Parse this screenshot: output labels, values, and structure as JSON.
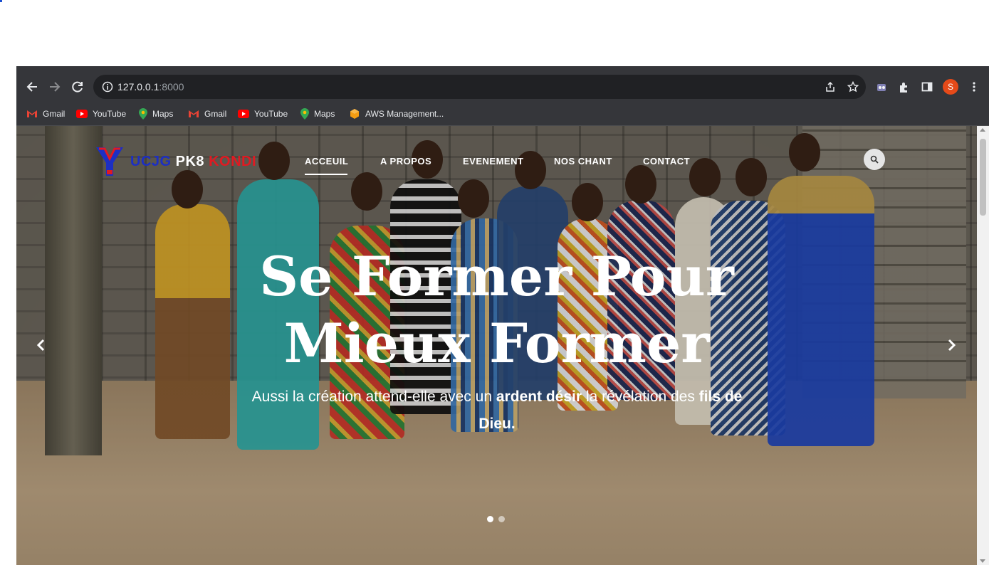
{
  "browser": {
    "url_host": "127.0.0.1",
    "url_port": ":8000",
    "profile_initial": "S",
    "bookmarks": [
      {
        "label": "Gmail",
        "icon": "gmail-icon"
      },
      {
        "label": "YouTube",
        "icon": "youtube-icon"
      },
      {
        "label": "Maps",
        "icon": "maps-icon"
      },
      {
        "label": "Gmail",
        "icon": "gmail-icon"
      },
      {
        "label": "YouTube",
        "icon": "youtube-icon"
      },
      {
        "label": "Maps",
        "icon": "maps-icon"
      },
      {
        "label": "AWS Management...",
        "icon": "aws-icon"
      }
    ]
  },
  "site": {
    "logo": {
      "part1": "UCJG ",
      "part2": "PK8 ",
      "part3": "KONDI"
    },
    "nav": [
      "ACCEUIL",
      "A PROPOS",
      "EVENEMENT",
      "NOS CHANT",
      "CONTACT"
    ],
    "hero": {
      "title_line1": "Se Former Pour",
      "title_line2": "Mieux Former",
      "sub_part1": "Aussi la création attend-elle avec un ",
      "sub_bold1": "ardent désir",
      "sub_part2": " la révélation des ",
      "sub_bold2": "fils de Dieu."
    },
    "slides": {
      "count": 2,
      "active": 1
    }
  },
  "colors": {
    "toolbar": "#35363a",
    "logo_blue": "#1c2fc4",
    "logo_red": "#e01a22",
    "avatar": "#e64a19"
  }
}
